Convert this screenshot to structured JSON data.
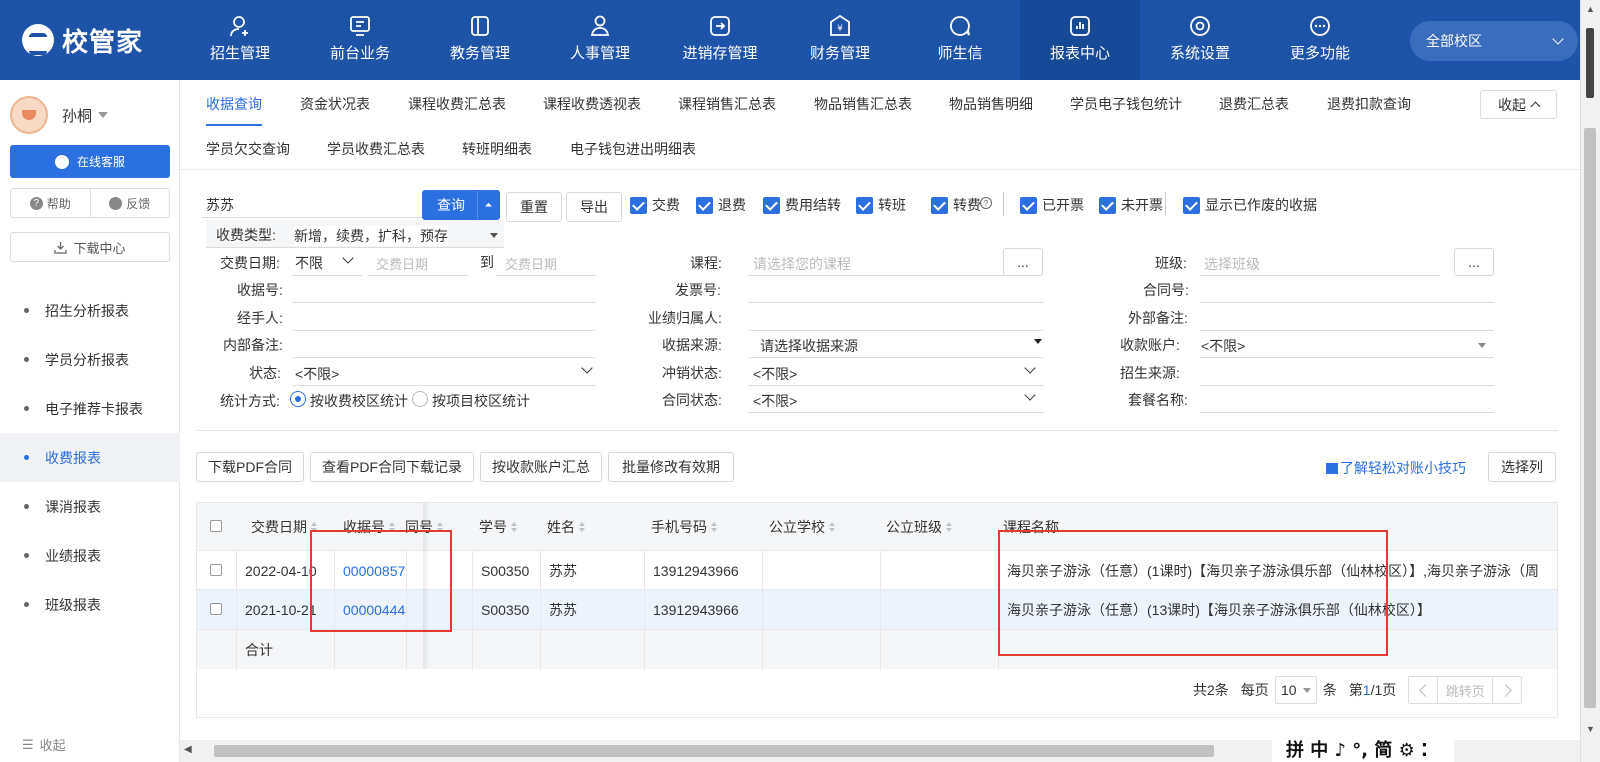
{
  "brand": {
    "logo_text": "校管家"
  },
  "topnav": [
    {
      "label": "招生管理",
      "icon": "user-plus-icon"
    },
    {
      "label": "前台业务",
      "icon": "monitor-icon"
    },
    {
      "label": "教务管理",
      "icon": "book-icon"
    },
    {
      "label": "人事管理",
      "icon": "person-icon"
    },
    {
      "label": "进销存管理",
      "icon": "exchange-icon"
    },
    {
      "label": "财务管理",
      "icon": "yen-icon"
    },
    {
      "label": "师生信",
      "icon": "chat-icon"
    },
    {
      "label": "报表中心",
      "icon": "chart-icon",
      "active": true
    },
    {
      "label": "系统设置",
      "icon": "settings-icon"
    },
    {
      "label": "更多功能",
      "icon": "more-icon"
    }
  ],
  "campus_select": "全部校区",
  "sidebar": {
    "username": "孙桐",
    "service_label": "在线客服",
    "help_label": "帮助",
    "feedback_label": "反馈",
    "download_label": "下载中心",
    "items": [
      "招生分析报表",
      "学员分析报表",
      "电子推荐卡报表",
      "收费报表",
      "课消报表",
      "业绩报表",
      "班级报表"
    ],
    "active_item": "收费报表",
    "collapse_label": "收起"
  },
  "tabs": {
    "row1": [
      "收据查询",
      "资金状况表",
      "课程收费汇总表",
      "课程收费透视表",
      "课程销售汇总表",
      "物品销售汇总表",
      "物品销售明细",
      "学员电子钱包统计",
      "退费汇总表",
      "退费扣款查询"
    ],
    "row2": [
      "学员欠交查询",
      "学员收费汇总表",
      "转班明细表",
      "电子钱包进出明细表"
    ],
    "active": "收据查询",
    "fold_label": "收起"
  },
  "filters": {
    "search_value": "苏苏",
    "query_label": "查询",
    "reset_label": "重置",
    "export_label": "导出",
    "checkboxes": [
      "交费",
      "退费",
      "费用结转",
      "转班",
      "转费",
      "已开票",
      "未开票",
      "显示已作废的收据"
    ],
    "fee_type_label": "收费类型:",
    "fee_type_value": "新增，续费，扩科，预存",
    "pay_date_label": "交费日期:",
    "pay_date_mode": "不限",
    "date_start_ph": "交费日期",
    "date_to": "到",
    "date_end_ph": "交费日期",
    "course_label": "课程:",
    "course_ph": "请选择您的课程",
    "class_label": "班级:",
    "class_ph": "选择班级",
    "ellipsis": "...",
    "receipt_label": "收据号:",
    "invoice_label": "发票号:",
    "contract_label": "合同号:",
    "handler_label": "经手人:",
    "owner_label": "业绩归属人:",
    "ext_note_label": "外部备注:",
    "int_note_label": "内部备注:",
    "source_label": "收据来源:",
    "source_value": "请选择收据来源",
    "account_label": "收款账户:",
    "account_value": "<不限>",
    "status_label": "状态:",
    "status_value": "<不限>",
    "writeoff_label": "冲销状态:",
    "writeoff_value": "<不限>",
    "recruit_label": "招生来源:",
    "stat_label": "统计方式:",
    "stat_opt1": "按收费校区统计",
    "stat_opt2": "按项目校区统计",
    "contract_status_label": "合同状态:",
    "contract_status_value": "<不限>",
    "package_label": "套餐名称:"
  },
  "actions": {
    "download_pdf": "下载PDF合同",
    "pdf_records": "查看PDF合同下载记录",
    "by_account": "按收款账户汇总",
    "batch_edit": "批量修改有效期",
    "tips_link": "了解轻松对账小技巧",
    "choose_cols": "选择列"
  },
  "table": {
    "headers": [
      "交费日期",
      "收据号",
      "同号",
      "学号",
      "姓名",
      "手机号码",
      "公立学校",
      "公立班级",
      "课程名称"
    ],
    "rows": [
      {
        "date": "2022-04-10",
        "receipt": "00000857",
        "sid": "S00350",
        "name": "苏苏",
        "phone": "13912943966",
        "course": "海贝亲子游泳（任意）(1课时)【海贝亲子游泳俱乐部（仙林校区）】,海贝亲子游泳（周"
      },
      {
        "date": "2021-10-21",
        "receipt": "00000444",
        "sid": "S00350",
        "name": "苏苏",
        "phone": "13912943966",
        "course": "海贝亲子游泳（任意）(13课时)【海贝亲子游泳俱乐部（仙林校区）】"
      }
    ],
    "total_label": "合计"
  },
  "pager": {
    "total_text": "共2条",
    "per_page_label": "每页",
    "per_page": "10",
    "unit": "条",
    "page_prefix": "第",
    "page_current": "1",
    "page_suffix": "/1页",
    "jump_ph": "跳转页"
  },
  "ime": {
    "text": "拼 中 ♪ °, 简 ⚙ ⁚"
  },
  "colors": {
    "nav_bg": "#1e54a8",
    "accent": "#2b6fe0",
    "highlight": "#e53935"
  }
}
